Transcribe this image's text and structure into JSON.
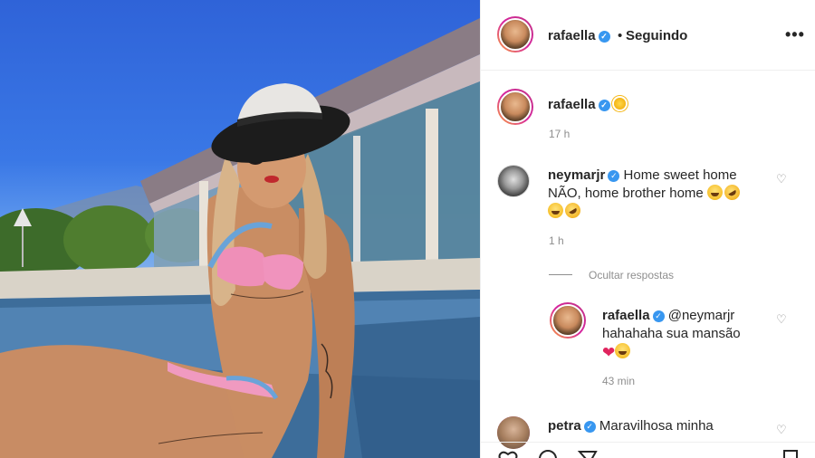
{
  "post_header": {
    "username": "rafaella",
    "separator": "•",
    "follow_status": "Seguindo",
    "more_label": "•••"
  },
  "caption": {
    "username": "rafaella",
    "emoji": "sun",
    "time": "17 h"
  },
  "comments": [
    {
      "username": "neymarjr",
      "line1": "Home sweet home",
      "line2": "NÃO, home brother home",
      "time": "1 h"
    }
  ],
  "hide_replies_label": "Ocultar respostas",
  "reply": {
    "username": "rafaella",
    "mention": "@neymarjr",
    "text": "hahahaha sua mansão",
    "time": "43 min"
  },
  "next_comment": {
    "username": "petra",
    "text": "Maravilhosa minha"
  },
  "icons": {
    "verified": "✓",
    "heart": "♡",
    "heart_filled": "❤"
  },
  "colors": {
    "verified_blue": "#3897f0",
    "muted": "#8e8e8e",
    "text": "#262626"
  }
}
